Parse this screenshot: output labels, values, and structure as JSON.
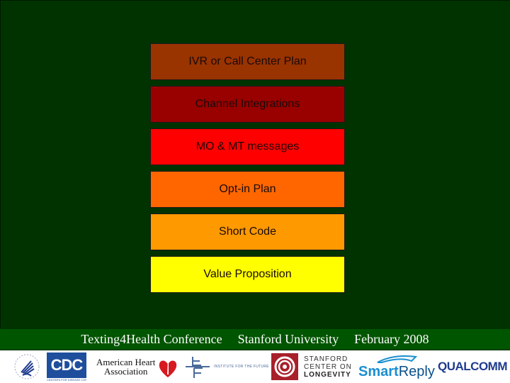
{
  "stack": {
    "layers": [
      {
        "label": "IVR or Call Center Plan",
        "color": "#993300"
      },
      {
        "label": "Channel Integrations",
        "color": "#990000"
      },
      {
        "label": "MO & MT messages",
        "color": "#ff0000"
      },
      {
        "label": "Opt-in Plan",
        "color": "#ff6600"
      },
      {
        "label": "Short Code",
        "color": "#ff9900"
      },
      {
        "label": "Value Proposition",
        "color": "#ffff00"
      }
    ]
  },
  "footer": {
    "conference": "Texting4Health Conference",
    "venue": "Stanford University",
    "date": "February 2008"
  },
  "logos": {
    "hhs": "HHS eagle seal",
    "cdc": "CDC",
    "cdc_sub": "CENTERS FOR DISEASE CONTROL AND PREVENTION",
    "aha_line1": "American Heart",
    "aha_line2": "Association",
    "iftf": "INSTITUTE FOR THE FUTURE",
    "longevity_line1": "STANFORD",
    "longevity_line2": "CENTER ON",
    "longevity_line3": "LONGEVITY",
    "smartreply_a": "Smart",
    "smartreply_b": "Reply",
    "qualcomm": "QUALCOMM"
  }
}
